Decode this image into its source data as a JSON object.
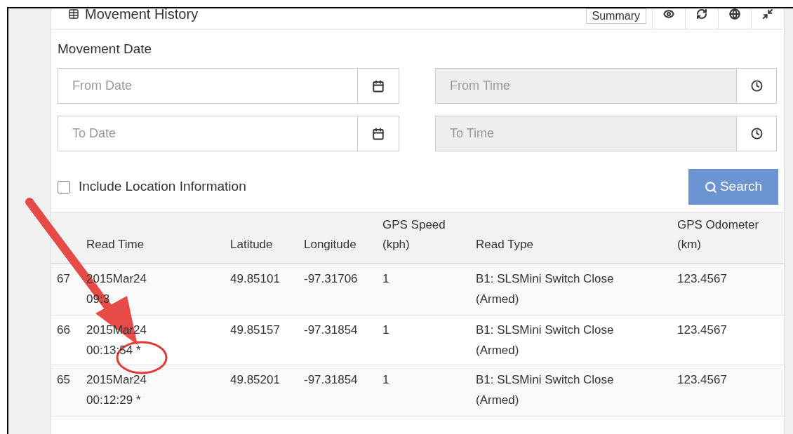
{
  "panel": {
    "title": "Movement History",
    "summary_button": "Summary"
  },
  "section_label": "Movement Date",
  "fields": [
    {
      "placeholder": "From Date",
      "kind": "date",
      "disabled": false
    },
    {
      "placeholder": "From Time",
      "kind": "time",
      "disabled": true
    },
    {
      "placeholder": "To Date",
      "kind": "date",
      "disabled": false
    },
    {
      "placeholder": "To Time",
      "kind": "time",
      "disabled": true
    }
  ],
  "include_location": {
    "label": "Include Location Information",
    "checked": false
  },
  "search_button": "Search",
  "table": {
    "columns": [
      "Read Time",
      "Latitude",
      "Longitude",
      "GPS Speed (kph)",
      "Read Type",
      "GPS Odometer (km)"
    ],
    "rows": [
      {
        "index": "67",
        "cells": [
          "2015Mar24 09:3",
          "49.85101",
          "-97.31706",
          "1",
          "B1: SLSMini Switch Close (Armed)",
          "123.4567"
        ]
      },
      {
        "index": "66",
        "cells": [
          "2015Mar24 00:13:54 *",
          "49.85157",
          "-97.31854",
          "1",
          "B1: SLSMini Switch Close (Armed)",
          "123.4567"
        ]
      },
      {
        "index": "65",
        "cells": [
          "2015Mar24 00:12:29 *",
          "49.85201",
          "-97.31854",
          "1",
          "B1: SLSMini Switch Close (Armed)",
          "123.4567"
        ]
      }
    ]
  }
}
